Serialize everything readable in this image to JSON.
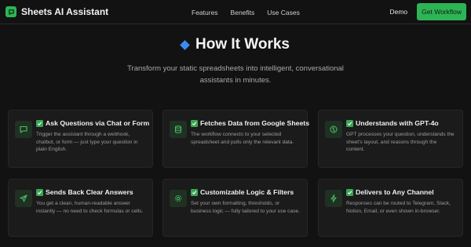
{
  "nav": {
    "brand": "Sheets AI Assistant",
    "links": [
      "Features",
      "Benefits",
      "Use Cases"
    ],
    "demo": "Demo",
    "cta": "Get Workflow"
  },
  "hero": {
    "title": "How It Works",
    "subtitle": "Transform your static spreadsheets into intelligent, conversational assistants in minutes."
  },
  "colors": {
    "accent": "#2db455",
    "background": "#121212",
    "card": "#1b1b1b"
  },
  "cards": [
    {
      "icon": "chat-icon",
      "title": "Ask Questions via Chat or Form",
      "desc": "Trigger the assistant through a webhook, chatbot, or form — just type your question in plain English."
    },
    {
      "icon": "database-icon",
      "title": "Fetches Data from Google Sheets",
      "desc": "The workflow connects to your selected spreadsheet and pulls only the relevant data."
    },
    {
      "icon": "brain-icon",
      "title": "Understands with GPT-4o",
      "desc": "GPT processes your question, understands the sheet's layout, and reasons through the content."
    },
    {
      "icon": "send-icon",
      "title": "Sends Back Clear Answers",
      "desc": "You get a clean, human-readable answer instantly — no need to check formulas or cells."
    },
    {
      "icon": "gear-icon",
      "title": "Customizable Logic & Filters",
      "desc": "Set your own formatting, thresholds, or business logic — fully tailored to your use case."
    },
    {
      "icon": "lightning-icon",
      "title": "Delivers to Any Channel",
      "desc": "Responses can be routed to Telegram, Slack, Notion, Email, or even shown in-browser."
    }
  ]
}
